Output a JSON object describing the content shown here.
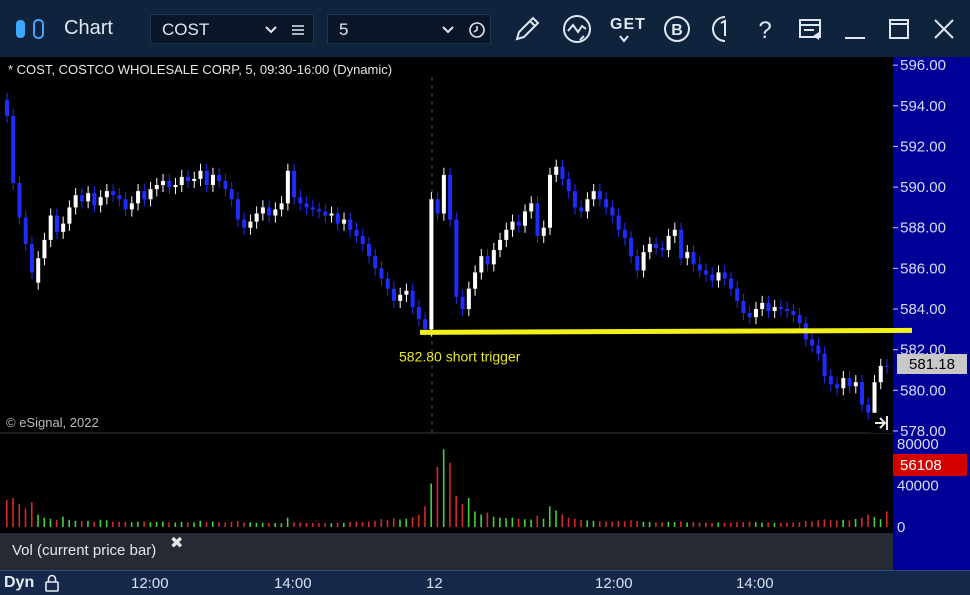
{
  "app": {
    "title": "Chart"
  },
  "toolbar": {
    "symbol": "COST",
    "interval": "5",
    "icons": [
      "pencil-icon",
      "study-icon",
      "get-icon",
      "b-icon",
      "info-icon",
      "help-icon",
      "page-layout-icon",
      "minimize-icon",
      "maximize-icon",
      "close-icon"
    ],
    "get_label": "GET"
  },
  "chart_header": "* COST, COSTCO WHOLESALE CORP, 5, 09:30-16:00 (Dynamic)",
  "watermark": "© eSignal, 2022",
  "annotation": {
    "text": "582.80 short trigger",
    "level": 582.8,
    "color": "#f2f21a"
  },
  "price_axis": {
    "ticks": [
      "596.00",
      "594.00",
      "592.00",
      "590.00",
      "588.00",
      "586.00",
      "584.00",
      "582.00",
      "580.00",
      "578.00"
    ],
    "last_price": "581.18"
  },
  "volume_axis": {
    "ticks": [
      "80000",
      "40000",
      "0"
    ],
    "last_volume": "56108"
  },
  "volume_pane_label": "Vol (current price bar)",
  "bottom": {
    "mode": "Dyn",
    "time_labels": [
      "12:00",
      "14:00",
      "12",
      "12:00",
      "14:00"
    ]
  },
  "colors": {
    "up": "#ffffff",
    "down": "#1f2cff",
    "vol_up": "#3fd33f",
    "vol_down": "#d42a2a",
    "last_volume_bg": "#d40000",
    "last_price_bg": "#c8c8c8"
  },
  "chart_data": {
    "type": "candlestick",
    "yrange": [
      577.9,
      596.4
    ],
    "close": [
      593.5,
      590.2,
      588.5,
      587.2,
      585.8,
      586.5,
      587.4,
      588.6,
      587.8,
      588.2,
      589.0,
      589.6,
      589.3,
      589.7,
      589.1,
      589.5,
      589.8,
      589.6,
      589.4,
      588.9,
      589.2,
      589.8,
      589.4,
      589.9,
      590.1,
      590.3,
      590.0,
      590.1,
      590.5,
      590.3,
      590.4,
      590.8,
      590.1,
      590.6,
      590.3,
      589.9,
      589.4,
      588.4,
      588.0,
      588.3,
      588.7,
      589.0,
      588.6,
      588.9,
      589.2,
      590.8,
      589.5,
      589.2,
      589.0,
      588.9,
      588.8,
      588.6,
      588.7,
      588.2,
      588.4,
      587.9,
      587.6,
      587.2,
      586.6,
      586.0,
      585.5,
      585.0,
      584.4,
      584.7,
      584.9,
      584.1,
      583.5,
      583.0,
      589.4,
      588.7,
      590.6,
      588.4,
      584.6,
      584.0,
      585.0,
      585.8,
      586.6,
      586.2,
      586.9,
      587.4,
      587.9,
      588.3,
      588.1,
      588.8,
      589.2,
      587.6,
      588.0,
      590.6,
      591.0,
      590.4,
      589.8,
      589.0,
      588.8,
      589.4,
      589.8,
      589.4,
      589.0,
      588.6,
      587.9,
      587.5,
      586.6,
      585.9,
      586.8,
      587.2,
      587.0,
      586.9,
      587.6,
      587.9,
      586.5,
      586.8,
      586.2,
      585.9,
      585.7,
      585.4,
      585.8,
      585.5,
      585.0,
      584.4,
      583.8,
      583.6,
      584.0,
      584.3,
      583.9,
      584.1,
      584.0,
      583.9,
      583.7,
      583.3,
      582.5,
      582.2,
      581.8,
      580.7,
      580.3,
      580.1,
      580.6,
      580.2,
      580.4,
      579.3,
      578.9,
      580.4,
      581.2,
      581.18
    ],
    "open": [
      594.3,
      593.5,
      590.2,
      588.5,
      587.2,
      585.3,
      586.5,
      587.4,
      588.6,
      587.8,
      588.2,
      589.0,
      589.6,
      589.3,
      589.7,
      589.1,
      589.5,
      589.8,
      589.6,
      589.4,
      588.9,
      589.2,
      589.8,
      589.4,
      589.9,
      590.1,
      590.3,
      590.0,
      590.1,
      590.5,
      590.3,
      590.4,
      590.8,
      590.1,
      590.6,
      590.3,
      589.9,
      589.4,
      588.4,
      588.0,
      588.3,
      588.7,
      589.0,
      588.6,
      588.9,
      589.2,
      590.8,
      589.5,
      589.2,
      589.0,
      588.9,
      588.8,
      588.6,
      588.7,
      588.2,
      588.4,
      587.9,
      587.6,
      587.2,
      586.6,
      586.0,
      585.5,
      585.0,
      584.4,
      584.7,
      584.9,
      584.1,
      583.5,
      583.0,
      589.4,
      588.7,
      590.6,
      588.4,
      584.6,
      584.0,
      585.0,
      585.8,
      586.6,
      586.2,
      586.9,
      587.4,
      587.9,
      588.3,
      588.1,
      588.8,
      589.2,
      587.6,
      588.0,
      590.6,
      591.0,
      590.4,
      589.8,
      589.0,
      588.8,
      589.4,
      589.8,
      589.4,
      589.0,
      588.6,
      587.9,
      587.5,
      586.6,
      585.9,
      586.8,
      587.2,
      587.0,
      586.9,
      587.6,
      587.9,
      586.5,
      586.8,
      586.2,
      585.9,
      585.7,
      585.4,
      585.8,
      585.5,
      585.0,
      584.4,
      583.8,
      583.6,
      584.0,
      584.3,
      583.9,
      584.1,
      584.0,
      583.9,
      583.7,
      583.3,
      582.5,
      582.2,
      581.8,
      580.7,
      580.3,
      580.1,
      580.6,
      580.2,
      580.4,
      579.3,
      578.9,
      580.4,
      581.2
    ],
    "volume": [
      26000,
      28000,
      22000,
      18000,
      24000,
      12000,
      9000,
      8000,
      7000,
      10000,
      7000,
      6000,
      5500,
      6000,
      5000,
      7000,
      6500,
      5200,
      5000,
      4800,
      4600,
      5100,
      5300,
      4700,
      4900,
      5200,
      4500,
      4300,
      5000,
      4600,
      4400,
      6000,
      4700,
      5200,
      4600,
      4300,
      5000,
      5800,
      4200,
      4300,
      4100,
      4000,
      3900,
      3800,
      3700,
      9000,
      4500,
      4200,
      4000,
      3900,
      3800,
      3700,
      3600,
      4100,
      3900,
      4800,
      5000,
      4700,
      5200,
      6000,
      7500,
      7000,
      8500,
      7200,
      8000,
      9500,
      12000,
      20000,
      42000,
      58000,
      75000,
      62000,
      30000,
      22000,
      28000,
      15000,
      12000,
      14000,
      10000,
      9000,
      8500,
      9000,
      8000,
      7500,
      7200,
      11000,
      8000,
      20000,
      16000,
      12000,
      9000,
      8000,
      7000,
      6500,
      6000,
      5500,
      5200,
      5000,
      6000,
      5500,
      6500,
      6000,
      5000,
      4800,
      4600,
      4500,
      5000,
      4700,
      5500,
      4400,
      4600,
      4300,
      4200,
      4000,
      4400,
      4100,
      4300,
      4600,
      4800,
      5200,
      4500,
      4200,
      4400,
      4100,
      4000,
      4300,
      4200,
      4600,
      6000,
      5200,
      6500,
      7500,
      6800,
      6200,
      7000,
      6400,
      7800,
      9000,
      12000,
      9500,
      7500,
      15000
    ]
  }
}
